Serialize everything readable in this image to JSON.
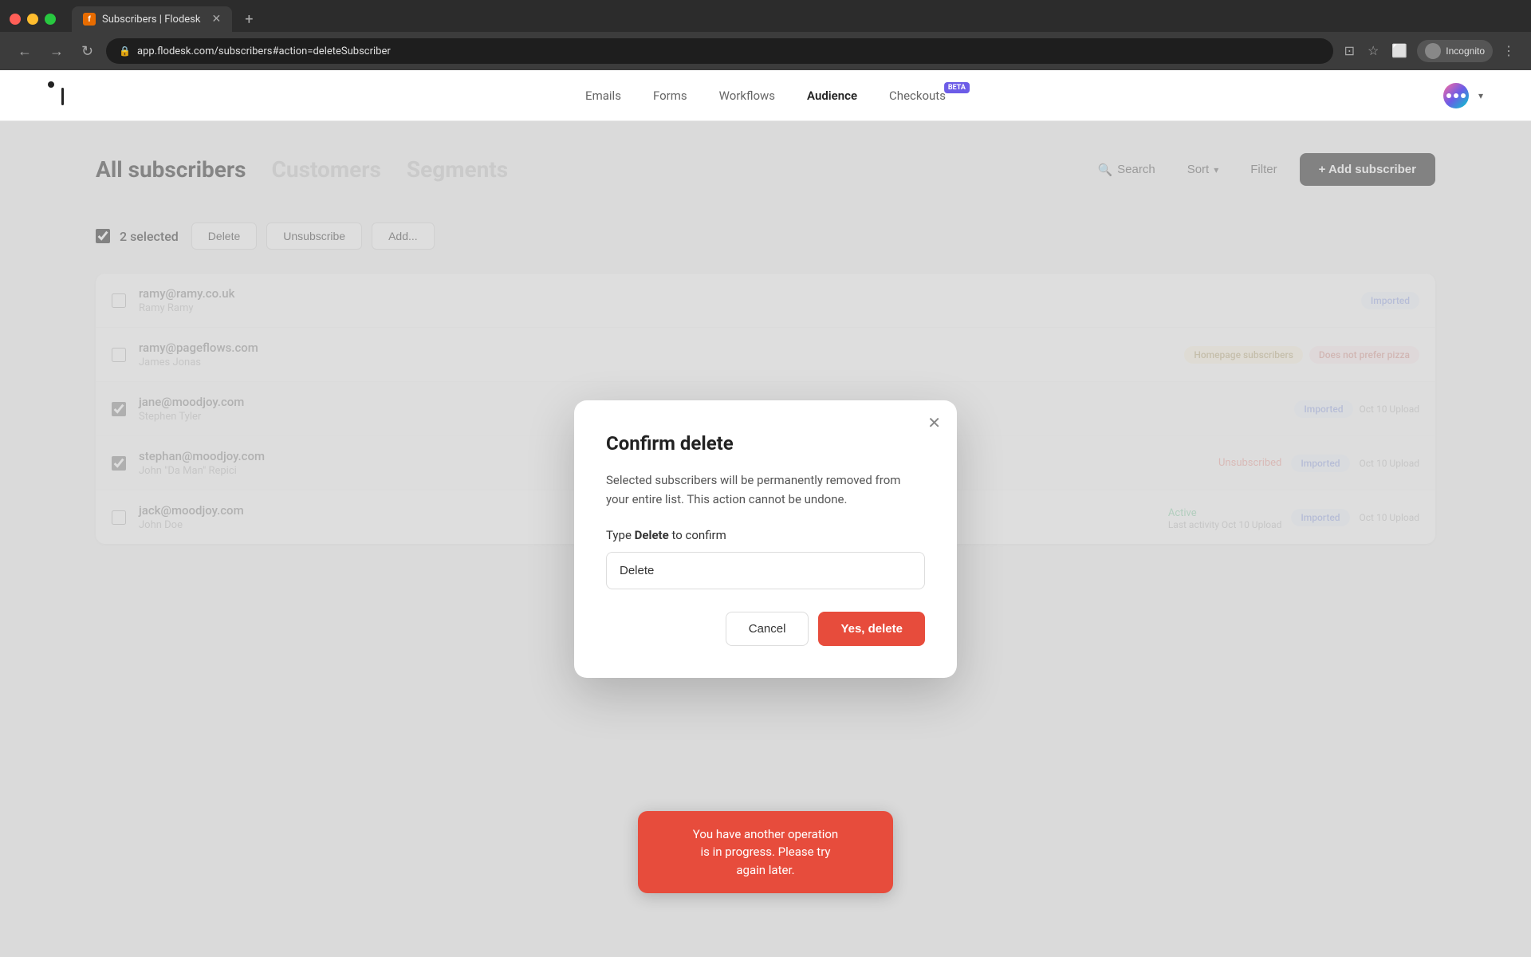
{
  "browser": {
    "tab_title": "Subscribers | Flodesk",
    "favicon_letter": "f",
    "url": "app.flodesk.com/subscribers#action=deleteSubscriber",
    "nav_back": "←",
    "nav_forward": "→",
    "nav_refresh": "↻",
    "incognito_label": "Incognito"
  },
  "nav": {
    "links": [
      {
        "label": "Emails",
        "active": false
      },
      {
        "label": "Forms",
        "active": false
      },
      {
        "label": "Workflows",
        "active": false
      },
      {
        "label": "Audience",
        "active": true
      },
      {
        "label": "Checkouts",
        "active": false,
        "beta": true
      }
    ],
    "beta_label": "BETA"
  },
  "page": {
    "tabs": [
      {
        "label": "All subscribers",
        "active": true
      },
      {
        "label": "Customers",
        "active": false
      },
      {
        "label": "Segments",
        "active": false
      }
    ],
    "search_label": "Search",
    "sort_label": "Sort",
    "filter_label": "Filter",
    "add_subscriber_label": "+ Add subscriber"
  },
  "toolbar": {
    "selected_count": "2 selected",
    "delete_label": "Delete",
    "unsubscribe_label": "Unsubscribe",
    "add_label": "Add..."
  },
  "subscribers": [
    {
      "email": "ramy@ramy.co.uk",
      "name": "Ramy Ramy",
      "status": "",
      "tags": [
        "Imported"
      ],
      "tag_colors": [
        "blue"
      ],
      "activity": "",
      "checked": false
    },
    {
      "email": "ramy@pageflows.com",
      "name": "James Jonas",
      "status": "",
      "tags": [
        "Homepage subscribers",
        "Does not prefer pizza"
      ],
      "tag_colors": [
        "yellow",
        "pink"
      ],
      "activity": "",
      "checked": false
    },
    {
      "email": "jane@moodjoy.com",
      "name": "Stephen Tyler",
      "status": "",
      "tags": [
        "Imported"
      ],
      "tag_colors": [
        "blue"
      ],
      "activity": "Oct 10 Upload",
      "checked": true
    },
    {
      "email": "stephan@moodjoy.com",
      "name": "John \"Da Man\" Repici",
      "status": "Unsubscribed",
      "status_type": "unsubscribed",
      "tags": [
        "Imported"
      ],
      "tag_colors": [
        "blue"
      ],
      "activity": "Oct 10 Upload",
      "checked": true
    },
    {
      "email": "jack@moodjoy.com",
      "name": "John Doe",
      "status": "Active",
      "status_type": "active",
      "tags": [
        "Imported"
      ],
      "tag_colors": [
        "blue"
      ],
      "activity": "Oct 10 Upload",
      "activity_prefix": "Last activity ",
      "checked": false
    }
  ],
  "modal": {
    "title": "Confirm delete",
    "description": "Selected subscribers will be permanently removed from your entire list. This action cannot be undone.",
    "type_label": "Type",
    "confirm_word": "Delete",
    "to_confirm_suffix": "to confirm",
    "input_value": "Delete",
    "cancel_label": "Cancel",
    "confirm_label": "Yes, delete"
  },
  "toast": {
    "line1": "You have another operation",
    "line2": "is in progress. Please try",
    "line3": "again later."
  }
}
